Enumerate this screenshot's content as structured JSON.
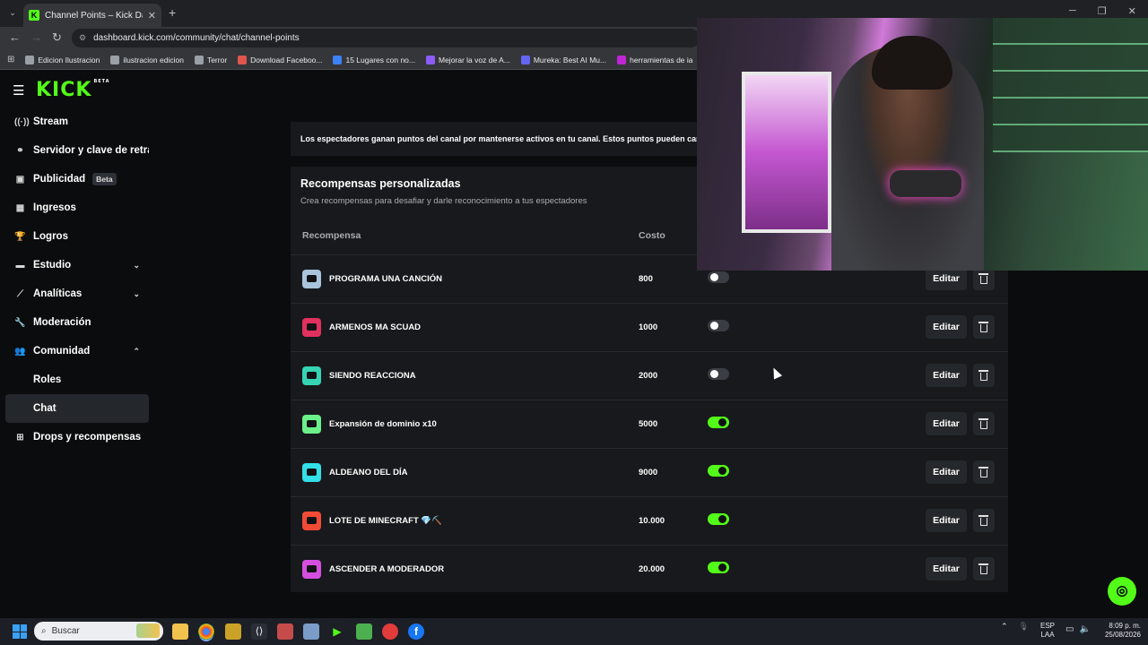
{
  "browser": {
    "tab_title": "Channel Points – Kick Dashboard",
    "tab_close": "✕",
    "new_tab": "+",
    "url": "dashboard.kick.com/community/chat/channel-points",
    "bookmarks": [
      {
        "label": "Edicion Ilustracion",
        "color": "#9aa0a6"
      },
      {
        "label": "ilustracion edicion",
        "color": "#9aa0a6"
      },
      {
        "label": "Terror",
        "color": "#9aa0a6"
      },
      {
        "label": "Download Faceboo...",
        "color": "#e0564d"
      },
      {
        "label": "15 Lugares con no...",
        "color": "#3b82f6"
      },
      {
        "label": "Mejorar la voz de A...",
        "color": "#8b5cf6"
      },
      {
        "label": "Mureka: Best AI Mu...",
        "color": "#6366f1"
      },
      {
        "label": "herramientas de ia",
        "color": "#c026d3"
      }
    ]
  },
  "header": {
    "logo": "KICK",
    "logo_badge": "BETA"
  },
  "sidebar": {
    "items": [
      {
        "label": "Stream",
        "icon": "broadcast-icon",
        "glyph": "((·))"
      },
      {
        "label": "Servidor y clave de retransmisión",
        "icon": "link-icon",
        "glyph": "⚭"
      },
      {
        "label": "Publicidad",
        "icon": "ad-icon",
        "glyph": "▣",
        "badge": "Beta"
      },
      {
        "label": "Ingresos",
        "icon": "chart-icon",
        "glyph": "▦"
      },
      {
        "label": "Logros",
        "icon": "trophy-icon",
        "glyph": "🏆"
      },
      {
        "label": "Estudio",
        "icon": "studio-icon",
        "glyph": "▬",
        "chevron": "⌄"
      },
      {
        "label": "Analíticas",
        "icon": "analytics-icon",
        "glyph": "⟋",
        "chevron": "⌄"
      },
      {
        "label": "Moderación",
        "icon": "wrench-icon",
        "glyph": "🔧"
      },
      {
        "label": "Comunidad",
        "icon": "people-icon",
        "glyph": "👥",
        "chevron": "⌃"
      },
      {
        "label": "Roles"
      },
      {
        "label": "Chat"
      },
      {
        "label": "Drops y recompensas",
        "icon": "gift-icon",
        "glyph": "⊞"
      }
    ]
  },
  "info": {
    "text": "Los espectadores ganan puntos del canal por mantenerse activos en tu canal. Estos puntos pueden canjearse por recompensas"
  },
  "rewards": {
    "title": "Recompensas personalizadas",
    "subtitle": "Crea recompensas para desafiar y darle reconocimiento a tus espectadores",
    "col_reward": "Recompensa",
    "col_cost": "Costo",
    "edit_label": "Editar",
    "rows": [
      {
        "name": "PROGRAMA UNA CANCIÓN",
        "cost": "800",
        "enabled": false,
        "color": "#a9c4dc"
      },
      {
        "name": "ARMENOS MA SCUAD",
        "cost": "1000",
        "enabled": false,
        "color": "#e0315f"
      },
      {
        "name": "SIENDO REACCIONA",
        "cost": "2000",
        "enabled": false,
        "color": "#36d3b4"
      },
      {
        "name": "Expansión de dominio x10",
        "cost": "5000",
        "enabled": true,
        "color": "#6bf08a"
      },
      {
        "name": "ALDEANO DEL DÍA",
        "cost": "9000",
        "enabled": true,
        "color": "#33dfe8"
      },
      {
        "name": "LOTE DE MINECRAFT 💎⛏️",
        "cost": "10.000",
        "enabled": true,
        "color": "#f04b37"
      },
      {
        "name": "ASCENDER A MODERADOR",
        "cost": "20.000",
        "enabled": true,
        "color": "#d44fe0"
      }
    ]
  },
  "taskbar": {
    "search_placeholder": "Buscar",
    "lang_top": "ESP",
    "lang_bottom": "LAA",
    "time": "8:09 p. m.",
    "date": "25/08/2026"
  },
  "colors": {
    "accent": "#53fc18",
    "panel": "#17191c",
    "background": "#0b0c0d"
  }
}
